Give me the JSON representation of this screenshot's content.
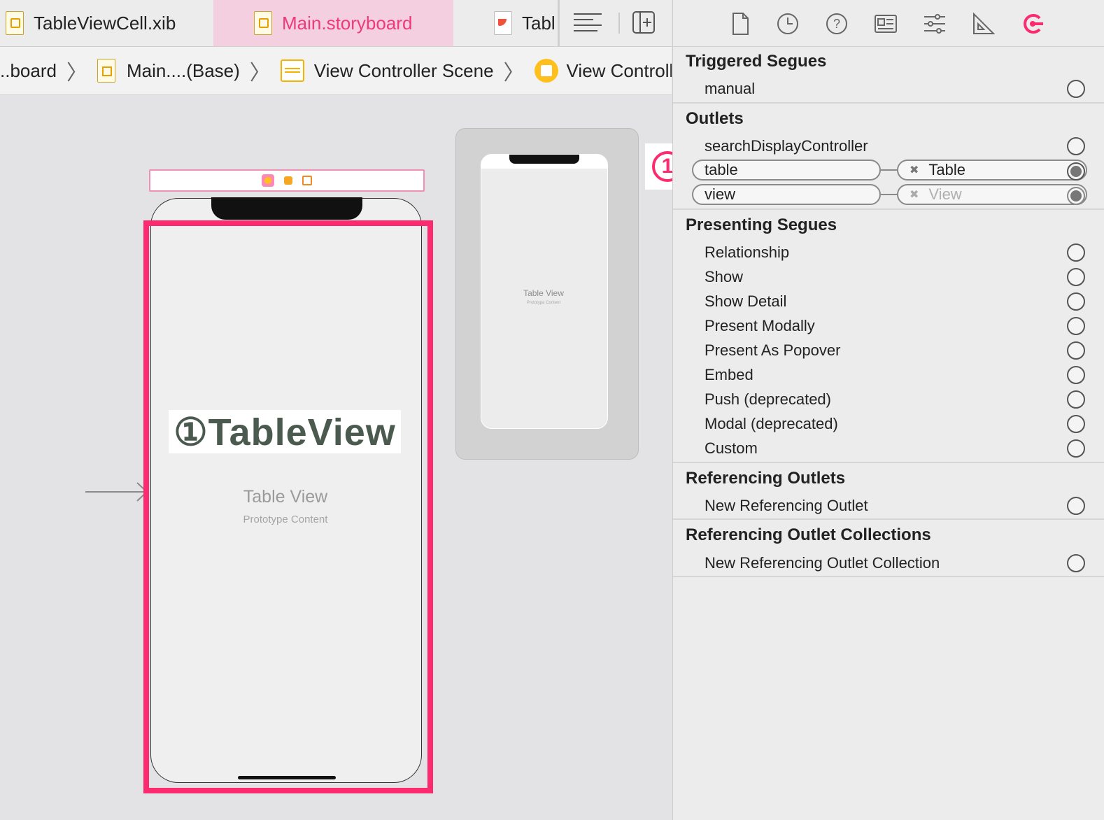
{
  "tabs": [
    {
      "label": "TableViewCell.xib",
      "active": false
    },
    {
      "label": "Main.storyboard",
      "active": true
    },
    {
      "label": "Tabl",
      "active": false
    }
  ],
  "breadcrumb": {
    "items": [
      "..board",
      "Main....(Base)",
      "View Controller Scene",
      "View Controller"
    ]
  },
  "canvas": {
    "annotation_label": "①TableView",
    "table_view_title": "Table View",
    "table_view_subtitle": "Prototype Content",
    "mini_title": "Table View",
    "mini_subtitle": "Prototype Content",
    "callout": "1"
  },
  "inspector": {
    "triggered_segues": {
      "title": "Triggered Segues",
      "items": [
        "manual"
      ]
    },
    "outlets": {
      "title": "Outlets",
      "search": "searchDisplayController",
      "table": {
        "name": "table",
        "target": "Table"
      },
      "view": {
        "name": "view",
        "target": "View"
      }
    },
    "presenting_segues": {
      "title": "Presenting Segues",
      "items": [
        "Relationship",
        "Show",
        "Show Detail",
        "Present Modally",
        "Present As Popover",
        "Embed",
        "Push (deprecated)",
        "Modal (deprecated)",
        "Custom"
      ]
    },
    "referencing_outlets": {
      "title": "Referencing Outlets",
      "item": "New Referencing Outlet"
    },
    "referencing_outlet_collections": {
      "title": "Referencing Outlet Collections",
      "item": "New Referencing Outlet Collection"
    }
  },
  "colors": {
    "accent": "#fc2a6e",
    "active_tab_bg": "#f4cfe0"
  }
}
